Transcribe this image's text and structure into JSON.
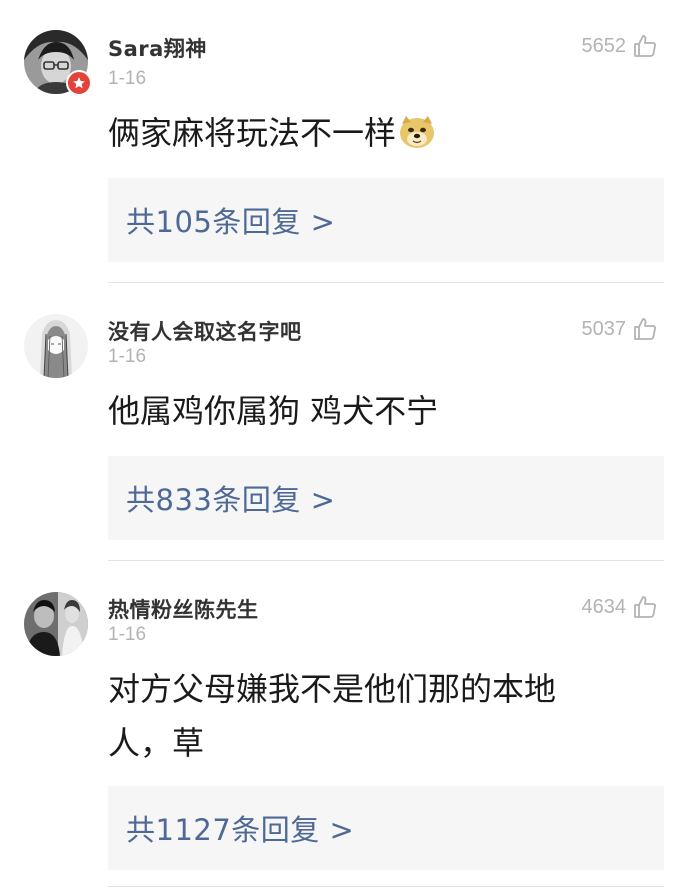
{
  "comments": [
    {
      "username": "Sara翔神",
      "date": "1-16",
      "likes": "5652",
      "text": "俩家麻将玩法不一样",
      "emoji": "doge-emoji",
      "reply_label": "共105条回复 >",
      "avatar": "avatar-photo-man-glasses",
      "verified_badge": true
    },
    {
      "username": "没有人会取这名字吧",
      "date": "1-16",
      "likes": "5037",
      "text": "他属鸡你属狗 鸡犬不宁",
      "reply_label": "共833条回复 >",
      "avatar": "avatar-illustration-long-hair",
      "verified_badge": false
    },
    {
      "username": "热情粉丝陈先生",
      "date": "1-16",
      "likes": "4634",
      "text_line1": "对方父母嫌我不是他们那的本地",
      "text_line2": "人，草",
      "reply_label": "共1127条回复 >",
      "avatar": "avatar-photo-couple",
      "verified_badge": false
    }
  ],
  "colors": {
    "reply_link": "#4e6996",
    "meta_gray": "#b3b3b3",
    "reply_bg": "#f6f6f6",
    "badge_red": "#e2433b"
  },
  "icons": {
    "like": "thumbs-up-outline-icon",
    "badge": "star-badge-icon"
  }
}
